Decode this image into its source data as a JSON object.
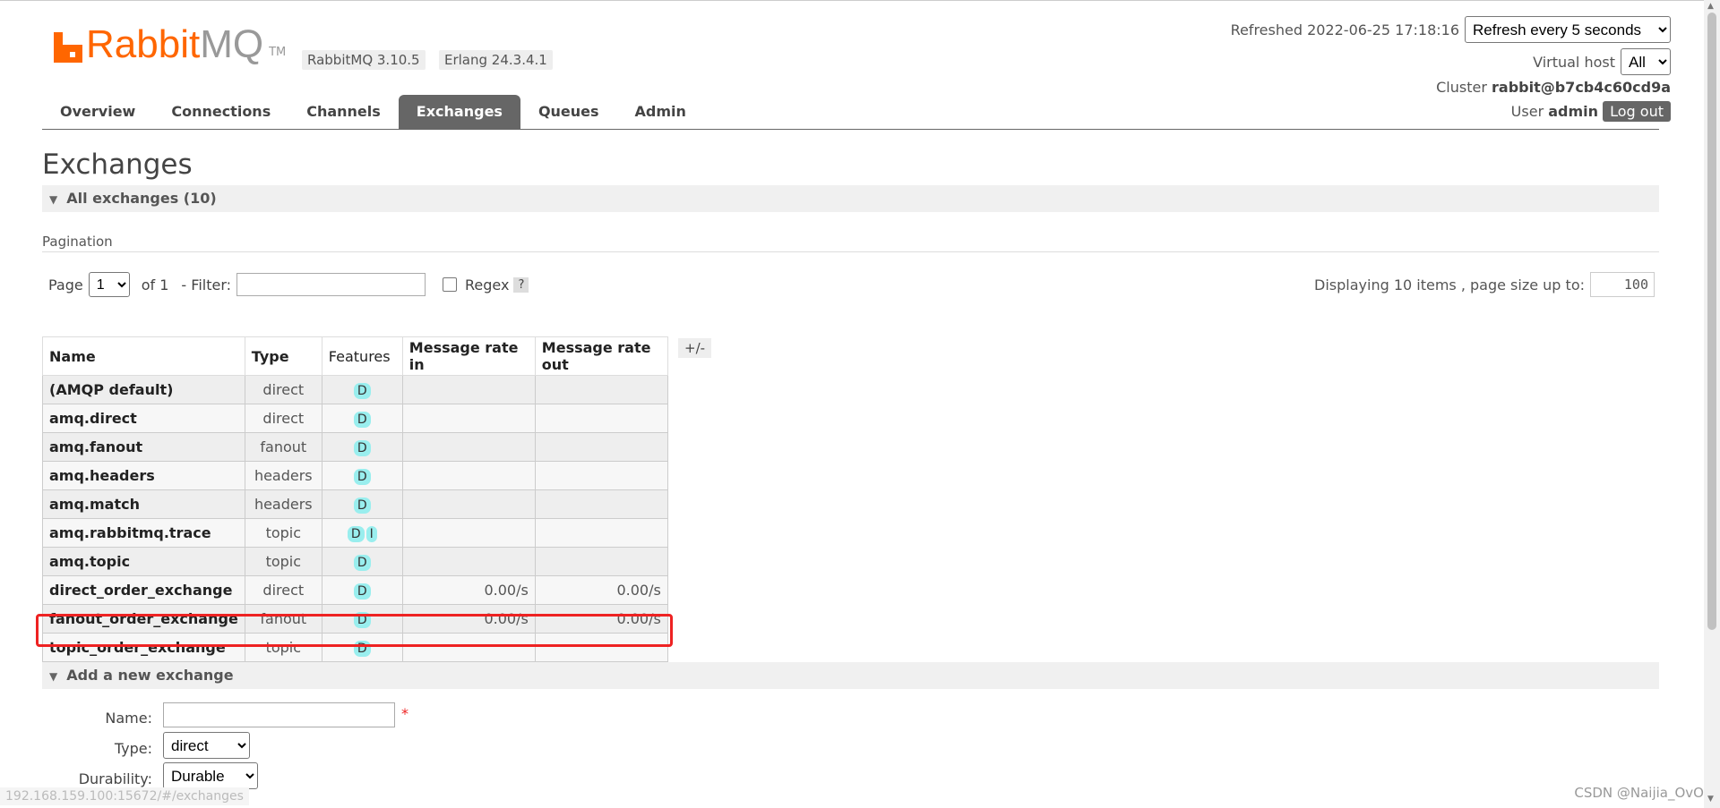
{
  "app": {
    "logo_rabbit": "Rabbit",
    "logo_mq": "MQ",
    "logo_tm": "TM",
    "version_rabbit": "RabbitMQ 3.10.5",
    "version_erlang": "Erlang 24.3.4.1"
  },
  "header": {
    "refreshed_label": "Refreshed 2022-06-25 17:18:16",
    "refresh_select": "Refresh every 5 seconds",
    "vhost_label": "Virtual host",
    "vhost_select": "All",
    "cluster_label": "Cluster",
    "cluster_value": "rabbit@b7cb4c60cd9a",
    "user_label": "User",
    "user_value": "admin",
    "logout_label": "Log out"
  },
  "nav": {
    "tabs": [
      "Overview",
      "Connections",
      "Channels",
      "Exchanges",
      "Queues",
      "Admin"
    ],
    "active": "Exchanges"
  },
  "page": {
    "title": "Exchanges",
    "all_exchanges": "All exchanges (10)",
    "pagination_label": "Pagination",
    "page_label": "Page",
    "page_value": "1",
    "of_label": "of 1",
    "filter_label": "- Filter:",
    "regex_label": "Regex",
    "help_label": "?",
    "display_info": "Displaying 10 items , page size up to:",
    "page_size": "100"
  },
  "table": {
    "headers": [
      "Name",
      "Type",
      "Features",
      "Message rate in",
      "Message rate out"
    ],
    "toggle_label": "+/-",
    "rows": [
      {
        "name": "(AMQP default)",
        "type": "direct",
        "features": [
          "D"
        ],
        "rate_in": "",
        "rate_out": ""
      },
      {
        "name": "amq.direct",
        "type": "direct",
        "features": [
          "D"
        ],
        "rate_in": "",
        "rate_out": ""
      },
      {
        "name": "amq.fanout",
        "type": "fanout",
        "features": [
          "D"
        ],
        "rate_in": "",
        "rate_out": ""
      },
      {
        "name": "amq.headers",
        "type": "headers",
        "features": [
          "D"
        ],
        "rate_in": "",
        "rate_out": ""
      },
      {
        "name": "amq.match",
        "type": "headers",
        "features": [
          "D"
        ],
        "rate_in": "",
        "rate_out": ""
      },
      {
        "name": "amq.rabbitmq.trace",
        "type": "topic",
        "features": [
          "D",
          "I"
        ],
        "rate_in": "",
        "rate_out": ""
      },
      {
        "name": "amq.topic",
        "type": "topic",
        "features": [
          "D"
        ],
        "rate_in": "",
        "rate_out": ""
      },
      {
        "name": "direct_order_exchange",
        "type": "direct",
        "features": [
          "D"
        ],
        "rate_in": "0.00/s",
        "rate_out": "0.00/s"
      },
      {
        "name": "fanout_order_exchange",
        "type": "fanout",
        "features": [
          "D"
        ],
        "rate_in": "0.00/s",
        "rate_out": "0.00/s"
      },
      {
        "name": "topic_order_exchange",
        "type": "topic",
        "features": [
          "D"
        ],
        "rate_in": "",
        "rate_out": ""
      }
    ]
  },
  "add_exchange": {
    "section_label": "Add a new exchange",
    "name_label": "Name:",
    "required_mark": "*",
    "type_label": "Type:",
    "type_value": "direct",
    "durability_label": "Durability:",
    "durability_value": "Durable"
  },
  "footer": {
    "status_url": "192.168.159.100:15672/#/exchanges",
    "watermark": "CSDN @Naijia_OvO"
  },
  "colors": {
    "brand": "#ff6600",
    "nav_active": "#666666",
    "badge": "#99eeee",
    "highlight": "#ee2222"
  }
}
